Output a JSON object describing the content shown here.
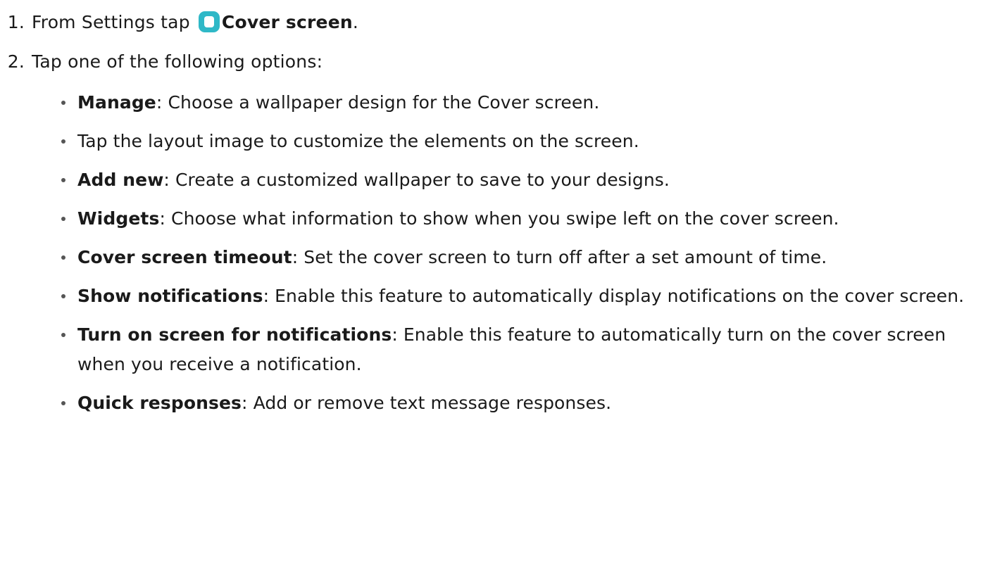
{
  "steps": [
    {
      "num": "1.",
      "prefix": "From Settings tap",
      "icon": "settings-cover-screen-icon",
      "icon_color": "#2fb8c7",
      "bold": "Cover screen",
      "suffix": "."
    },
    {
      "num": "2.",
      "text": "Tap one of the following options:"
    }
  ],
  "options": [
    {
      "term": "Manage",
      "desc": ": Choose a wallpaper design for the Cover screen."
    },
    {
      "term": "",
      "desc": "Tap the layout image to customize the elements on the screen."
    },
    {
      "term": "Add new",
      "desc": ": Create a customized wallpaper to save to your designs."
    },
    {
      "term": "Widgets",
      "desc": ": Choose what information to show when you swipe left on the cover screen."
    },
    {
      "term": "Cover screen timeout",
      "desc": ": Set the cover screen to turn off after a set amount of time."
    },
    {
      "term": "Show notifications",
      "desc": ": Enable this feature to automatically display notifications on the cover screen."
    },
    {
      "term": "Turn on screen for notifications",
      "desc": ": Enable this feature to automatically turn on the cover screen when you receive a notification."
    },
    {
      "term": "Quick responses",
      "desc": ": Add or remove text message responses."
    }
  ]
}
